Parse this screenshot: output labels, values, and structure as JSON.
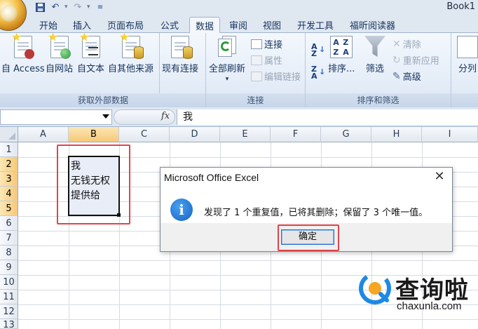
{
  "window": {
    "title": "Book1"
  },
  "tabs": [
    {
      "label": "开始"
    },
    {
      "label": "插入"
    },
    {
      "label": "页面布局"
    },
    {
      "label": "公式"
    },
    {
      "label": "数据",
      "active": true
    },
    {
      "label": "审阅"
    },
    {
      "label": "视图"
    },
    {
      "label": "开发工具"
    },
    {
      "label": "福昕阅读器"
    }
  ],
  "ribbon": {
    "get_external": {
      "label": "获取外部数据",
      "buttons": [
        "自 Access",
        "自网站",
        "自文本",
        "自其他来源"
      ]
    },
    "existing": "现有连接",
    "connections": {
      "label": "连接",
      "refresh_all": "全部刷新",
      "items": [
        "连接",
        "属性",
        "编辑链接"
      ]
    },
    "sort_filter": {
      "label": "排序和筛选",
      "sort": "排序...",
      "filter": "筛选",
      "items": [
        "清除",
        "重新应用",
        "高级"
      ]
    },
    "split": "分列"
  },
  "formula_bar": {
    "fx": "fx",
    "value": "我"
  },
  "columns": [
    "A",
    "B",
    "C",
    "D",
    "E",
    "F",
    "G",
    "H",
    "I"
  ],
  "rows": [
    "1",
    "2",
    "3",
    "4",
    "5",
    "6",
    "7",
    "8",
    "9",
    "10",
    "11",
    "12",
    "13"
  ],
  "selected_column": "B",
  "selected_rows": [
    "2",
    "3",
    "4",
    "5"
  ],
  "cells": [
    {
      "ref": "B2",
      "value": "我"
    },
    {
      "ref": "B3",
      "value": "无钱无权"
    },
    {
      "ref": "B4",
      "value": "提供给"
    }
  ],
  "dialog": {
    "title": "Microsoft Office Excel",
    "message": "发现了 1 个重复值，已将其删除；保留了 3 个唯一值。",
    "ok": "确定",
    "close": "✕",
    "info_glyph": "i"
  },
  "watermark": {
    "name": "查询啦",
    "url": "chaxunla.com"
  },
  "colors": {
    "accent_blue": "#1463c4",
    "highlight_red": "#e0454a",
    "selection_header": "#f6c878"
  }
}
